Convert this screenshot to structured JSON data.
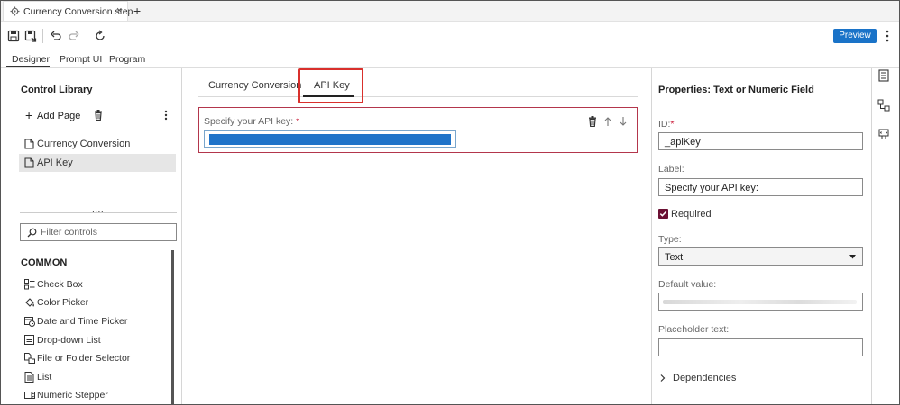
{
  "file_tab": {
    "title": "Currency Conversion.step",
    "close": "×",
    "new_tab": "+"
  },
  "toolbar": {
    "preview_label": "Preview"
  },
  "mode_tabs": [
    {
      "label": "Designer",
      "selected": true
    },
    {
      "label": "Prompt UI",
      "selected": false
    },
    {
      "label": "Program",
      "selected": false
    }
  ],
  "left_panel": {
    "title": "Control Library",
    "add_page_label": "Add Page",
    "pages": [
      {
        "label": "Currency Conversion",
        "selected": false
      },
      {
        "label": "API Key",
        "selected": true
      }
    ],
    "splitter": "....",
    "filter_placeholder": "Filter controls",
    "section_title": "COMMON",
    "controls": [
      {
        "label": "Check Box",
        "icon": "checkbox-list-icon"
      },
      {
        "label": "Color Picker",
        "icon": "paint-bucket-icon"
      },
      {
        "label": "Date and Time Picker",
        "icon": "calendar-clock-icon"
      },
      {
        "label": "Drop-down List",
        "icon": "dropdown-list-icon"
      },
      {
        "label": "File or Folder Selector",
        "icon": "file-folder-icon"
      },
      {
        "label": "List",
        "icon": "list-document-icon"
      },
      {
        "label": "Numeric Stepper",
        "icon": "numeric-stepper-icon"
      }
    ]
  },
  "page_tabs": [
    {
      "label": "Currency Conversion",
      "selected": false
    },
    {
      "label": "API Key",
      "selected": true
    }
  ],
  "canvas_field": {
    "label": "Specify your API key:",
    "required_mark": "*"
  },
  "properties": {
    "title": "Properties: Text or Numeric Field",
    "id_label": "ID:",
    "id_required_mark": "*",
    "id_value": "_apiKey",
    "label_label": "Label:",
    "label_value": "Specify your API key:",
    "required_label": "Required",
    "required_checked": true,
    "type_label": "Type:",
    "type_value": "Text",
    "default_label": "Default value:",
    "placeholder_label": "Placeholder text:",
    "placeholder_value": "",
    "dependencies_label": "Dependencies"
  },
  "colors": {
    "accent": "#1a73c8",
    "highlight": "#d9302c",
    "field_border": "#b3364c",
    "checkbox": "#6b1033",
    "required": "#c8102e"
  }
}
